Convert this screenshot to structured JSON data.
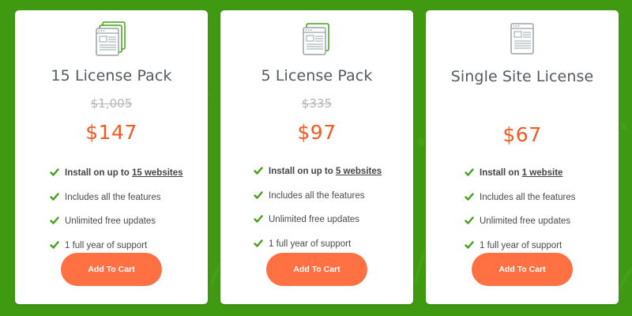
{
  "colors": {
    "background": "#3f9a12",
    "accent_price": "#f05a24",
    "button": "#ff7043",
    "check": "#44a017"
  },
  "plans": [
    {
      "title": "15 License Pack",
      "old_price": "$1,005",
      "price": "$147",
      "icon": "stacked-documents-icon",
      "features": [
        {
          "prefix": "Install on up to ",
          "link": "15 websites"
        },
        {
          "text": "Includes all the features"
        },
        {
          "text": "Unlimited free updates"
        },
        {
          "text": "1 full year of support"
        }
      ],
      "button": "Add To Cart"
    },
    {
      "title": "5 License Pack",
      "old_price": "$335",
      "price": "$97",
      "icon": "stacked-documents-icon",
      "features": [
        {
          "prefix": "Install on up to ",
          "link": "5 websites"
        },
        {
          "text": "Includes all the features"
        },
        {
          "text": "Unlimited free updates"
        },
        {
          "text": "1 full year of support"
        }
      ],
      "button": "Add To Cart"
    },
    {
      "title": "Single Site License",
      "old_price": "",
      "price": "$67",
      "icon": "document-icon",
      "features": [
        {
          "prefix": "Install on ",
          "link": "1 website"
        },
        {
          "text": "Includes all the features"
        },
        {
          "text": "Unlimited free updates"
        },
        {
          "text": "1 full year of support"
        }
      ],
      "button": "Add To Cart"
    }
  ]
}
